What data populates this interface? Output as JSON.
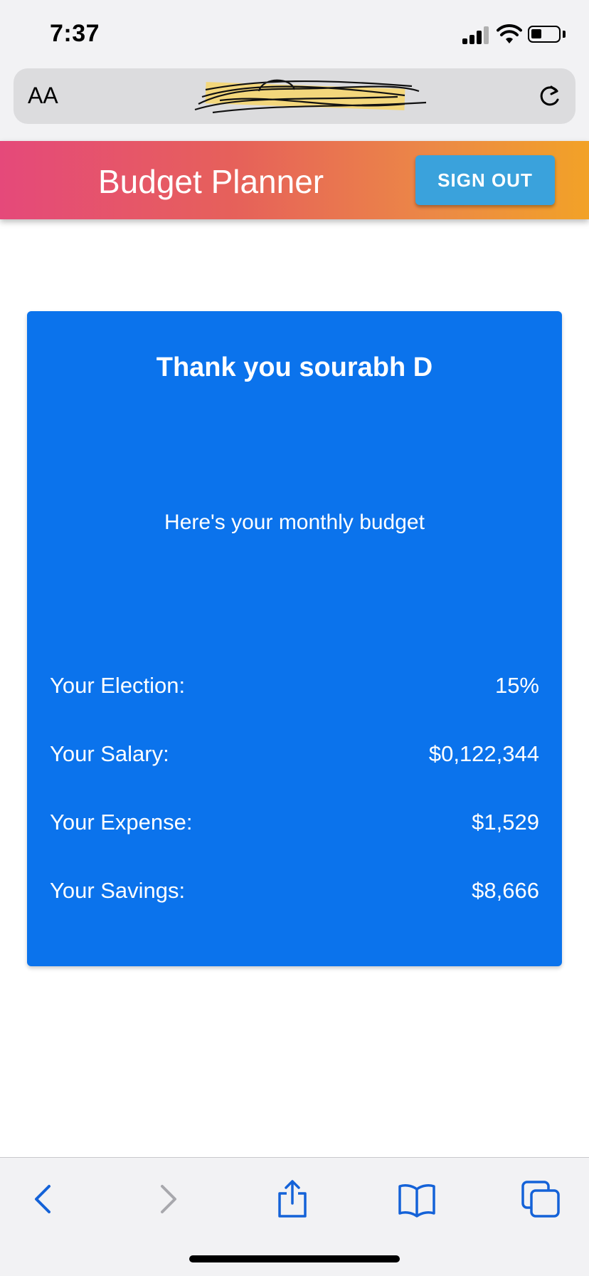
{
  "status_bar": {
    "time": "7:37",
    "icons": [
      "signal-icon",
      "wifi-icon",
      "battery-icon"
    ]
  },
  "browser": {
    "text_size_label": "AA",
    "url": "",
    "reload_icon": "reload-icon"
  },
  "header": {
    "title": "Budget Planner",
    "sign_out_label": "SIGN OUT",
    "colors": {
      "gradient_start": "#e5497a",
      "gradient_end": "#f2a227",
      "button": "#3aa2dc"
    }
  },
  "card": {
    "title": "Thank you sourabh D",
    "subtitle": "Here's your monthly budget",
    "color": "#0b73ec",
    "rows": [
      {
        "label": "Your Election:",
        "value": "15%"
      },
      {
        "label": "Your Salary:",
        "value": "$0,122,344"
      },
      {
        "label": "Your Expense:",
        "value": "$1,529"
      },
      {
        "label": "Your Savings:",
        "value": "$8,666"
      }
    ]
  },
  "toolbar": {
    "icons": [
      "back-icon",
      "forward-icon",
      "share-icon",
      "bookmarks-icon",
      "tabs-icon"
    ],
    "accent": "#1462d8"
  }
}
